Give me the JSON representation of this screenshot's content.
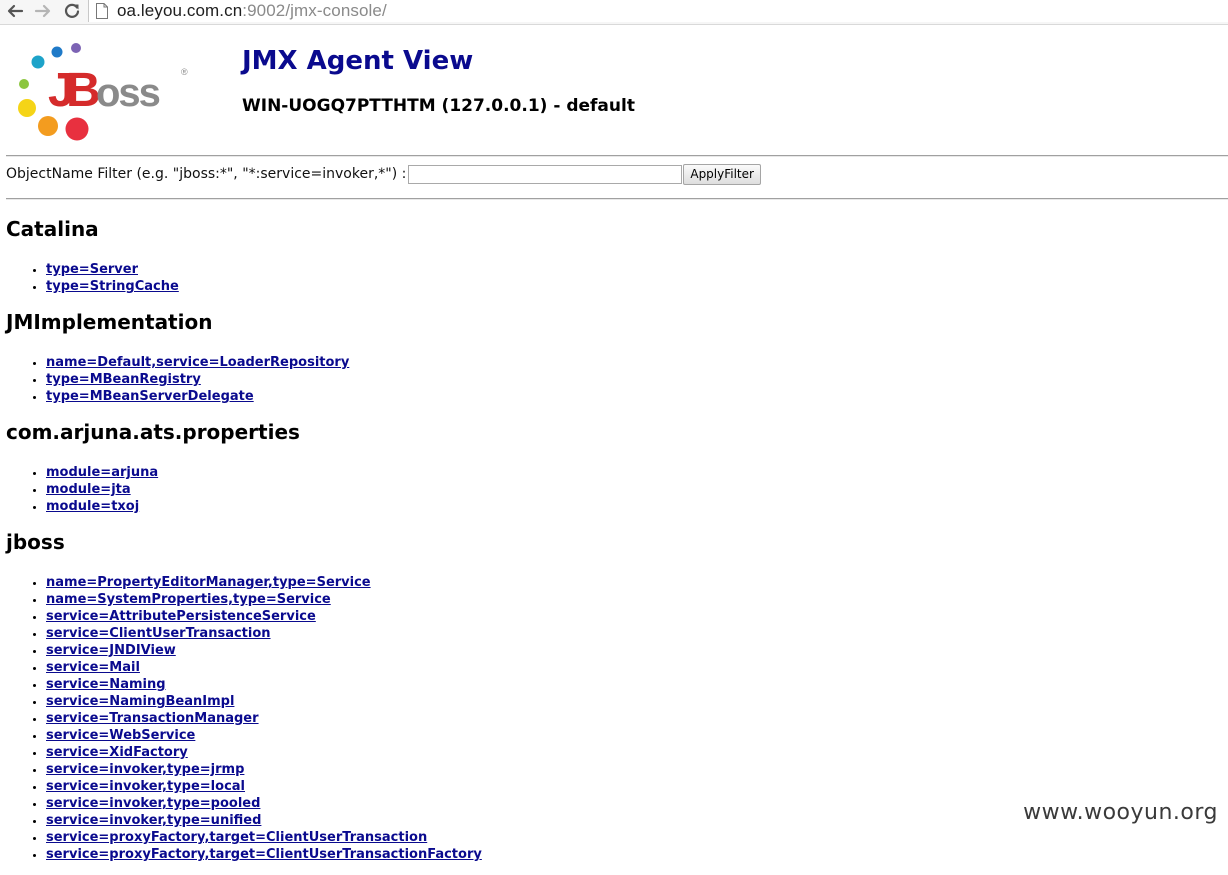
{
  "browser": {
    "url_host": "oa.leyou.com.cn",
    "url_rest": ":9002/jmx-console/"
  },
  "header": {
    "logo_text": "JBoss",
    "title": "JMX Agent View",
    "subtitle": "WIN-UOGQ7PTTHTM (127.0.0.1) - default"
  },
  "filter": {
    "label": "ObjectName Filter (e.g. \"jboss:*\", \"*:service=invoker,*\") :",
    "value": "",
    "button_label": "ApplyFilter"
  },
  "domains": [
    {
      "name": "Catalina",
      "mbeans": [
        "type=Server",
        "type=StringCache"
      ]
    },
    {
      "name": "JMImplementation",
      "mbeans": [
        "name=Default,service=LoaderRepository",
        "type=MBeanRegistry",
        "type=MBeanServerDelegate"
      ]
    },
    {
      "name": "com.arjuna.ats.properties",
      "mbeans": [
        "module=arjuna",
        "module=jta",
        "module=txoj"
      ]
    },
    {
      "name": "jboss",
      "mbeans": [
        "name=PropertyEditorManager,type=Service",
        "name=SystemProperties,type=Service",
        "service=AttributePersistenceService",
        "service=ClientUserTransaction",
        "service=JNDIView",
        "service=Mail",
        "service=Naming",
        "service=NamingBeanImpl",
        "service=TransactionManager",
        "service=WebService",
        "service=XidFactory",
        "service=invoker,type=jrmp",
        "service=invoker,type=local",
        "service=invoker,type=pooled",
        "service=invoker,type=unified",
        "service=proxyFactory,target=ClientUserTransaction",
        "service=proxyFactory,target=ClientUserTransactionFactory"
      ]
    }
  ],
  "watermark": "www.wooyun.org",
  "colors": {
    "link": "#0a0a8e",
    "title": "#0a0a8e"
  }
}
